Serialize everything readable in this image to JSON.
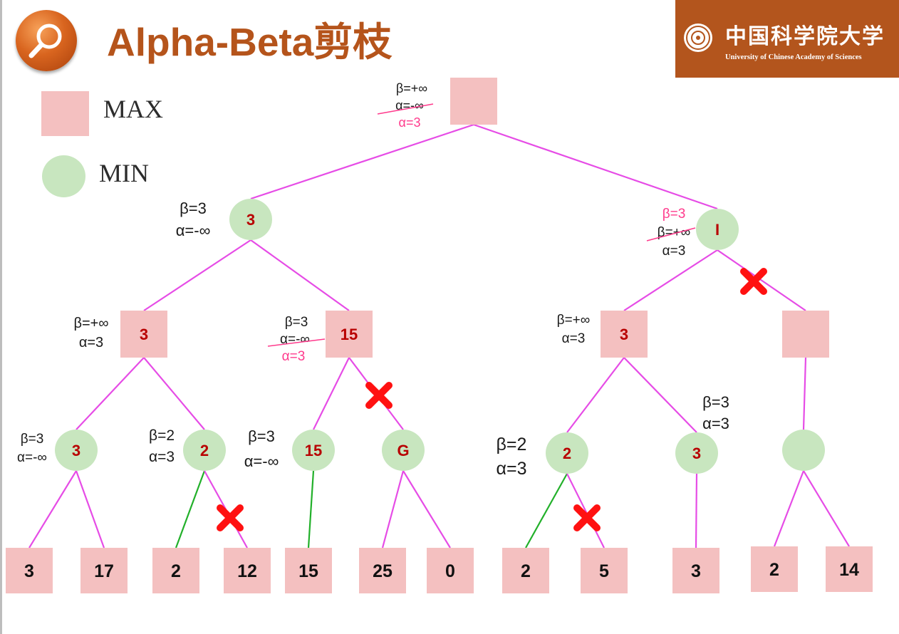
{
  "title": "Alpha-Beta剪枝",
  "logo": {
    "cn": "中国科学院大学",
    "en": "University of Chinese Academy of Sciences"
  },
  "legend": {
    "max": "MAX",
    "min": "MIN"
  },
  "colors": {
    "max_fill": "#f4c0c0",
    "min_fill": "#c8e6bf",
    "edge": "#e64ce6",
    "kept_edge": "#22b02a",
    "value": "#b80000",
    "cross": "#ff1111",
    "update": "#ff3a8c",
    "title": "#b5541b"
  },
  "nodes": [
    {
      "id": "root",
      "type": "max",
      "value": ""
    },
    {
      "id": "a",
      "type": "min",
      "value": "3"
    },
    {
      "id": "b",
      "type": "min",
      "value": "I"
    },
    {
      "id": "a1",
      "type": "max",
      "value": "3"
    },
    {
      "id": "a2",
      "type": "max",
      "value": "15"
    },
    {
      "id": "b1",
      "type": "max",
      "value": "3"
    },
    {
      "id": "b2",
      "type": "max",
      "value": ""
    },
    {
      "id": "m1",
      "type": "min",
      "value": "3"
    },
    {
      "id": "m2",
      "type": "min",
      "value": "2"
    },
    {
      "id": "m3",
      "type": "min",
      "value": "15"
    },
    {
      "id": "m4",
      "type": "min",
      "value": "G"
    },
    {
      "id": "m5",
      "type": "min",
      "value": "2"
    },
    {
      "id": "m6",
      "type": "min",
      "value": "3"
    },
    {
      "id": "m7",
      "type": "min",
      "value": ""
    },
    {
      "id": "l1",
      "type": "leaf",
      "value": "3"
    },
    {
      "id": "l2",
      "type": "leaf",
      "value": "17"
    },
    {
      "id": "l3",
      "type": "leaf",
      "value": "2"
    },
    {
      "id": "l4",
      "type": "leaf",
      "value": "12"
    },
    {
      "id": "l5",
      "type": "leaf",
      "value": "15"
    },
    {
      "id": "l6",
      "type": "leaf",
      "value": "25"
    },
    {
      "id": "l7",
      "type": "leaf",
      "value": "0"
    },
    {
      "id": "l8",
      "type": "leaf",
      "value": "2"
    },
    {
      "id": "l9",
      "type": "leaf",
      "value": "5"
    },
    {
      "id": "l10",
      "type": "leaf",
      "value": "3"
    },
    {
      "id": "l11",
      "type": "leaf",
      "value": "2"
    },
    {
      "id": "l12",
      "type": "leaf",
      "value": "14"
    }
  ],
  "edges": [
    {
      "from": "root",
      "to": "a",
      "style": "normal"
    },
    {
      "from": "root",
      "to": "b",
      "style": "normal"
    },
    {
      "from": "a",
      "to": "a1",
      "style": "normal"
    },
    {
      "from": "a",
      "to": "a2",
      "style": "normal"
    },
    {
      "from": "b",
      "to": "b1",
      "style": "normal"
    },
    {
      "from": "b",
      "to": "b2",
      "style": "pruned"
    },
    {
      "from": "a1",
      "to": "m1",
      "style": "normal"
    },
    {
      "from": "a1",
      "to": "m2",
      "style": "normal"
    },
    {
      "from": "a2",
      "to": "m3",
      "style": "normal"
    },
    {
      "from": "a2",
      "to": "m4",
      "style": "pruned"
    },
    {
      "from": "b1",
      "to": "m5",
      "style": "normal"
    },
    {
      "from": "b1",
      "to": "m6",
      "style": "normal"
    },
    {
      "from": "b2",
      "to": "m7",
      "style": "normal"
    },
    {
      "from": "m1",
      "to": "l1",
      "style": "normal"
    },
    {
      "from": "m1",
      "to": "l2",
      "style": "normal"
    },
    {
      "from": "m2",
      "to": "l3",
      "style": "kept"
    },
    {
      "from": "m2",
      "to": "l4",
      "style": "pruned"
    },
    {
      "from": "m3",
      "to": "l5",
      "style": "kept"
    },
    {
      "from": "m4",
      "to": "l6",
      "style": "normal"
    },
    {
      "from": "m4",
      "to": "l7",
      "style": "normal"
    },
    {
      "from": "m5",
      "to": "l8",
      "style": "kept"
    },
    {
      "from": "m5",
      "to": "l9",
      "style": "pruned"
    },
    {
      "from": "m6",
      "to": "l10",
      "style": "normal"
    },
    {
      "from": "m7",
      "to": "l11",
      "style": "normal"
    },
    {
      "from": "m7",
      "to": "l12",
      "style": "normal"
    }
  ],
  "annotations": [
    {
      "id": "root-beta",
      "text": "β=+∞",
      "kind": "normal"
    },
    {
      "id": "root-alpha-old",
      "text": "α=-∞",
      "kind": "struck"
    },
    {
      "id": "root-alpha-new",
      "text": "α=3",
      "kind": "update"
    },
    {
      "id": "a-beta",
      "text": "β=3",
      "kind": "normal"
    },
    {
      "id": "a-alpha",
      "text": "α=-∞",
      "kind": "normal"
    },
    {
      "id": "b-beta-new",
      "text": "β=3",
      "kind": "update"
    },
    {
      "id": "b-beta-old",
      "text": "β=+∞",
      "kind": "struck"
    },
    {
      "id": "b-alpha",
      "text": "α=3",
      "kind": "normal"
    },
    {
      "id": "a1-beta",
      "text": "β=+∞",
      "kind": "normal"
    },
    {
      "id": "a1-alpha",
      "text": "α=3",
      "kind": "normal"
    },
    {
      "id": "a2-beta",
      "text": "β=3",
      "kind": "normal"
    },
    {
      "id": "a2-alpha-old",
      "text": "α=-∞",
      "kind": "struck"
    },
    {
      "id": "a2-alpha-new",
      "text": "α=3",
      "kind": "update"
    },
    {
      "id": "b1-beta",
      "text": "β=+∞",
      "kind": "normal"
    },
    {
      "id": "b1-alpha",
      "text": "α=3",
      "kind": "normal"
    },
    {
      "id": "m1-beta",
      "text": "β=3",
      "kind": "normal"
    },
    {
      "id": "m1-alpha",
      "text": "α=-∞",
      "kind": "normal"
    },
    {
      "id": "m2-beta",
      "text": "β=2",
      "kind": "normal"
    },
    {
      "id": "m2-alpha",
      "text": "α=3",
      "kind": "normal"
    },
    {
      "id": "m3-beta",
      "text": "β=3",
      "kind": "normal"
    },
    {
      "id": "m3-alpha",
      "text": "α=-∞",
      "kind": "normal"
    },
    {
      "id": "m5-beta",
      "text": "β=2",
      "kind": "normal"
    },
    {
      "id": "m5-alpha",
      "text": "α=3",
      "kind": "normal"
    },
    {
      "id": "m6-beta",
      "text": "β=3",
      "kind": "normal"
    },
    {
      "id": "m6-alpha",
      "text": "α=3",
      "kind": "normal"
    }
  ]
}
